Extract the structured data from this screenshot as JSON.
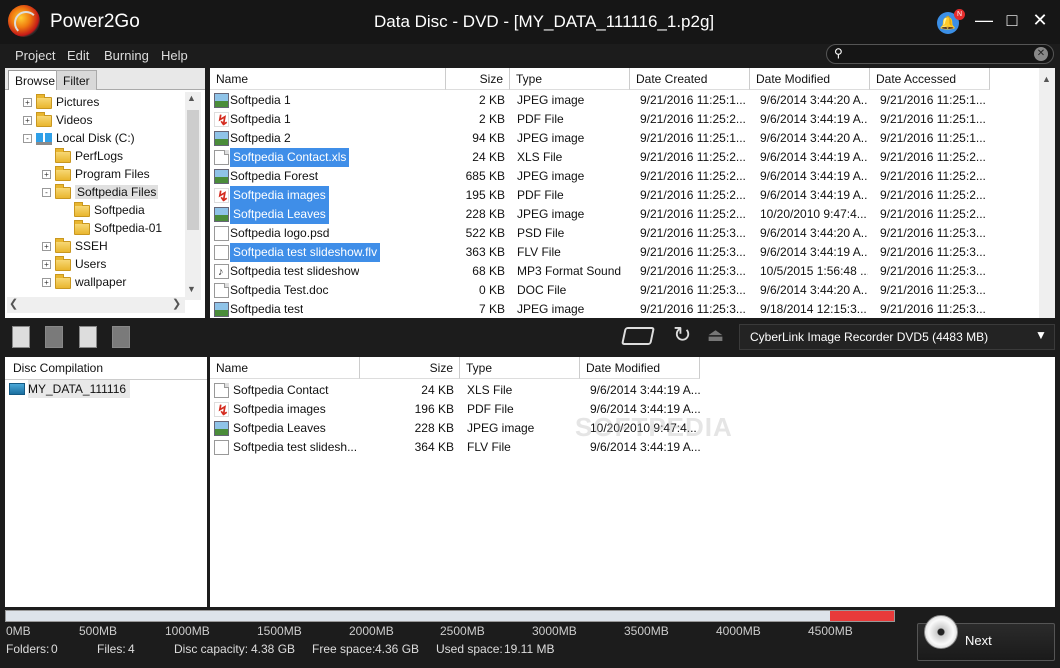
{
  "app": {
    "name": "Power2Go",
    "window_title": "Data Disc - DVD - [MY_DATA_111116_1.p2g]",
    "notification_badge": "N"
  },
  "menu": [
    {
      "label": "Project",
      "accel": "P"
    },
    {
      "label": "Edit",
      "accel": "E"
    },
    {
      "label": "Burning",
      "accel": "B"
    },
    {
      "label": "Help",
      "accel": "H"
    }
  ],
  "search": {
    "placeholder": ""
  },
  "browser_tabs": [
    "Browse",
    "Filter"
  ],
  "tree": [
    {
      "label": "Pictures",
      "indent": 1,
      "icon": "folder-icon",
      "exp": "+"
    },
    {
      "label": "Videos",
      "indent": 1,
      "icon": "folder-icon",
      "exp": "+"
    },
    {
      "label": "Local Disk (C:)",
      "indent": 1,
      "icon": "disk-icon",
      "exp": "-"
    },
    {
      "label": "PerfLogs",
      "indent": 2,
      "icon": "folder-icon",
      "exp": ""
    },
    {
      "label": "Program Files",
      "indent": 2,
      "icon": "folder-icon",
      "exp": "+"
    },
    {
      "label": "Softpedia Files",
      "indent": 2,
      "icon": "folder-icon",
      "exp": "-",
      "selected": true
    },
    {
      "label": "Softpedia",
      "indent": 3,
      "icon": "folder-icon",
      "exp": ""
    },
    {
      "label": "Softpedia-01",
      "indent": 3,
      "icon": "folder-icon",
      "exp": ""
    },
    {
      "label": "SSEH",
      "indent": 2,
      "icon": "folder-icon",
      "exp": "+"
    },
    {
      "label": "Users",
      "indent": 2,
      "icon": "folder-icon",
      "exp": "+"
    },
    {
      "label": "wallpaper",
      "indent": 2,
      "icon": "folder-icon",
      "exp": "+"
    }
  ],
  "file_columns": [
    "Name",
    "Size",
    "Type",
    "Date Created",
    "Date Modified",
    "Date Accessed"
  ],
  "files": [
    {
      "name": "Softpedia 1",
      "size": "2 KB",
      "type": "JPEG image",
      "created": "9/21/2016 11:25:1...",
      "modified": "9/6/2014 3:44:20 A...",
      "accessed": "9/21/2016 11:25:1...",
      "icon": "jpg",
      "selected": false
    },
    {
      "name": "Softpedia 1",
      "size": "2 KB",
      "type": "PDF File",
      "created": "9/21/2016 11:25:2...",
      "modified": "9/6/2014 3:44:19 A...",
      "accessed": "9/21/2016 11:25:1...",
      "icon": "pdf",
      "selected": false
    },
    {
      "name": "Softpedia 2",
      "size": "94 KB",
      "type": "JPEG image",
      "created": "9/21/2016 11:25:1...",
      "modified": "9/6/2014 3:44:20 A...",
      "accessed": "9/21/2016 11:25:1...",
      "icon": "jpg",
      "selected": false
    },
    {
      "name": "Softpedia Contact.xls",
      "size": "24 KB",
      "type": "XLS File",
      "created": "9/21/2016 11:25:2...",
      "modified": "9/6/2014 3:44:19 A...",
      "accessed": "9/21/2016 11:25:2...",
      "icon": "doc",
      "selected": true
    },
    {
      "name": "Softpedia Forest",
      "size": "685 KB",
      "type": "JPEG image",
      "created": "9/21/2016 11:25:2...",
      "modified": "9/6/2014 3:44:19 A...",
      "accessed": "9/21/2016 11:25:2...",
      "icon": "jpg",
      "selected": false
    },
    {
      "name": "Softpedia images",
      "size": "195 KB",
      "type": "PDF File",
      "created": "9/21/2016 11:25:2...",
      "modified": "9/6/2014 3:44:19 A...",
      "accessed": "9/21/2016 11:25:2...",
      "icon": "pdf",
      "selected": true
    },
    {
      "name": "Softpedia Leaves",
      "size": "228 KB",
      "type": "JPEG image",
      "created": "9/21/2016 11:25:2...",
      "modified": "10/20/2010 9:47:4...",
      "accessed": "9/21/2016 11:25:2...",
      "icon": "jpg",
      "selected": true
    },
    {
      "name": "Softpedia logo.psd",
      "size": "522 KB",
      "type": "PSD File",
      "created": "9/21/2016 11:25:3...",
      "modified": "9/6/2014 3:44:20 A...",
      "accessed": "9/21/2016 11:25:3...",
      "icon": "psd",
      "selected": false
    },
    {
      "name": "Softpedia test slideshow.flv",
      "size": "363 KB",
      "type": "FLV File",
      "created": "9/21/2016 11:25:3...",
      "modified": "9/6/2014 3:44:19 A...",
      "accessed": "9/21/2016 11:25:3...",
      "icon": "flv",
      "selected": true
    },
    {
      "name": "Softpedia test slideshow",
      "size": "68 KB",
      "type": "MP3 Format Sound",
      "created": "9/21/2016 11:25:3...",
      "modified": "10/5/2015 1:56:48 ...",
      "accessed": "9/21/2016 11:25:3...",
      "icon": "mp3",
      "selected": false
    },
    {
      "name": "Softpedia Test.doc",
      "size": "0 KB",
      "type": "DOC File",
      "created": "9/21/2016 11:25:3...",
      "modified": "9/6/2014 3:44:20 A...",
      "accessed": "9/21/2016 11:25:3...",
      "icon": "doc",
      "selected": false
    },
    {
      "name": "Softpedia test",
      "size": "7 KB",
      "type": "JPEG image",
      "created": "9/21/2016 11:25:3...",
      "modified": "9/18/2014 12:15:3...",
      "accessed": "9/21/2016 11:25:3...",
      "icon": "jpg",
      "selected": false
    }
  ],
  "recorder": {
    "label": "CyberLink Image Recorder DVD5 (4483 MB)"
  },
  "compilation": {
    "header": "Disc Compilation",
    "item": "MY_DATA_111116"
  },
  "disc_columns": [
    "Name",
    "Size",
    "Type",
    "Date Modified"
  ],
  "disc_files": [
    {
      "name": "Softpedia Contact",
      "size": "24 KB",
      "type": "XLS File",
      "modified": "9/6/2014 3:44:19 A...",
      "icon": "doc"
    },
    {
      "name": "Softpedia images",
      "size": "196 KB",
      "type": "PDF File",
      "modified": "9/6/2014 3:44:19 A...",
      "icon": "pdf"
    },
    {
      "name": "Softpedia Leaves",
      "size": "228 KB",
      "type": "JPEG image",
      "modified": "10/20/2010 9:47:4...",
      "icon": "jpg"
    },
    {
      "name": "Softpedia test slidesh...",
      "size": "364 KB",
      "type": "FLV File",
      "modified": "9/6/2014 3:44:19 A...",
      "icon": "flv"
    }
  ],
  "watermark": "SOFTPEDIA",
  "capacity_ticks": [
    "0MB",
    "500MB",
    "1000MB",
    "1500MB",
    "2000MB",
    "2500MB",
    "3000MB",
    "3500MB",
    "4000MB",
    "4500MB"
  ],
  "status": {
    "folders_label": "Folders:",
    "folders": "0",
    "files_label": "Files:",
    "files": "4",
    "capacity_label": "Disc capacity:",
    "capacity": "4.38 GB",
    "free_label": "Free space:",
    "free": "4.36 GB",
    "used_label": "Used space:",
    "used": "19.11 MB"
  },
  "next_button": "Next",
  "colors": {
    "selection": "#3f8ee8",
    "capacity_over": "#e83a3a",
    "bell": "#3b8fe6"
  }
}
